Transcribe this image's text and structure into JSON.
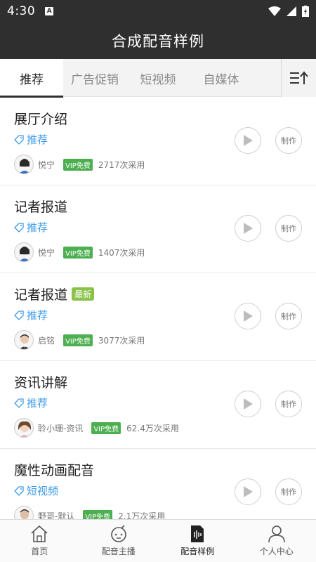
{
  "status": {
    "time": "4:30",
    "a_icon": "A"
  },
  "header": {
    "title": "合成配音样例"
  },
  "tabs": [
    {
      "label": "推荐",
      "active": true
    },
    {
      "label": "广告促销",
      "active": false
    },
    {
      "label": "短视频",
      "active": false
    },
    {
      "label": "自媒体",
      "active": false
    }
  ],
  "tab_menu_icon": "list-sort-icon",
  "items": [
    {
      "title": "展厅介绍",
      "badge": "",
      "tag": "推荐",
      "author": "悦宁",
      "vip": "VIP免费",
      "uses": "2717次采用",
      "play_label": "",
      "make_label": "制作"
    },
    {
      "title": "记者报道",
      "badge": "",
      "tag": "推荐",
      "author": "悦宁",
      "vip": "VIP免费",
      "uses": "1407次采用",
      "play_label": "",
      "make_label": "制作"
    },
    {
      "title": "记者报道",
      "badge": "最新",
      "tag": "推荐",
      "author": "启铭",
      "vip": "VIP免费",
      "uses": "3077次采用",
      "play_label": "",
      "make_label": "制作"
    },
    {
      "title": "资讯讲解",
      "badge": "",
      "tag": "推荐",
      "author": "聆小珊-资讯",
      "vip": "VIP免费",
      "uses": "62.4万次采用",
      "play_label": "",
      "make_label": "制作"
    },
    {
      "title": "魔性动画配音",
      "badge": "",
      "tag": "短视频",
      "author": "野哥-默认",
      "vip": "VIP免费",
      "uses": "2.1万次采用",
      "play_label": "",
      "make_label": "制作"
    }
  ],
  "bottom_nav": [
    {
      "label": "首页",
      "icon": "home-icon",
      "active": false
    },
    {
      "label": "配音主播",
      "icon": "robot-icon",
      "active": false
    },
    {
      "label": "配音样例",
      "icon": "audio-file-icon",
      "active": true
    },
    {
      "label": "个人中心",
      "icon": "person-icon",
      "active": false
    }
  ],
  "colors": {
    "bar": "#2f2f2f",
    "tag_blue": "#3c9be8",
    "vip_green": "#4caf50",
    "new_green": "#8bc34a"
  }
}
